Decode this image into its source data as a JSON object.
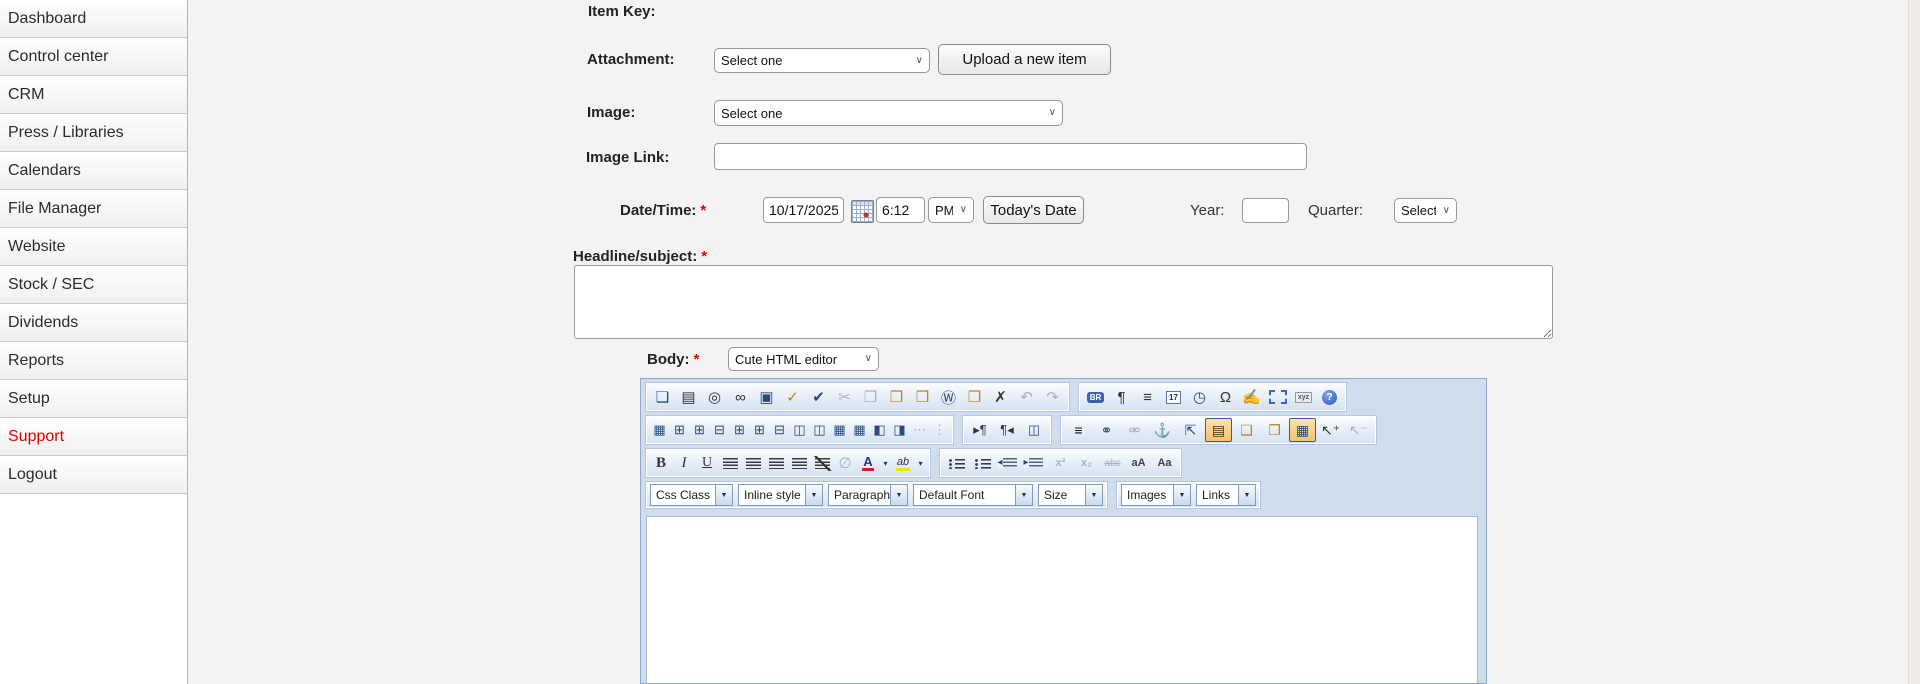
{
  "sidebar": {
    "items": [
      {
        "label": "Dashboard"
      },
      {
        "label": "Control center"
      },
      {
        "label": "CRM"
      },
      {
        "label": "Press / Libraries"
      },
      {
        "label": "Calendars"
      },
      {
        "label": "File Manager"
      },
      {
        "label": "Website"
      },
      {
        "label": "Stock / SEC"
      },
      {
        "label": "Dividends"
      },
      {
        "label": "Reports"
      },
      {
        "label": "Setup"
      },
      {
        "label": "Support"
      },
      {
        "label": "Logout"
      }
    ]
  },
  "form": {
    "item_key": {
      "label": "Item Key:"
    },
    "attachment": {
      "label": "Attachment:",
      "select_value": "Select one",
      "upload_button": "Upload a new item"
    },
    "image": {
      "label": "Image:",
      "select_value": "Select one"
    },
    "image_link": {
      "label": "Image Link:",
      "value": ""
    },
    "datetime": {
      "label": "Date/Time:",
      "required_mark": "*",
      "date_value": "10/17/2025",
      "time_value": "6:12",
      "ampm_value": "PM",
      "today_button": "Today's Date",
      "year_label": "Year:",
      "year_value": "",
      "quarter_label": "Quarter:",
      "quarter_value": "Select"
    },
    "headline": {
      "label": "Headline/subject:",
      "required_mark": "*",
      "value": ""
    },
    "body": {
      "label": "Body:",
      "required_mark": "*",
      "editor_select_value": "Cute HTML editor"
    }
  },
  "editor": {
    "toolbar": {
      "r1g1": [
        {
          "name": "new-document",
          "glyph": "❏"
        },
        {
          "name": "print",
          "glyph": "▤"
        },
        {
          "name": "print-preview",
          "glyph": "◎"
        },
        {
          "name": "find",
          "glyph": "∞"
        },
        {
          "name": "select-all",
          "glyph": "▣"
        },
        {
          "name": "spell-check-as-you-type",
          "glyph": "✓"
        },
        {
          "name": "spell-check",
          "glyph": "✔"
        },
        {
          "name": "cut",
          "glyph": "✂"
        },
        {
          "name": "copy",
          "glyph": "❐"
        },
        {
          "name": "paste",
          "glyph": "❒"
        },
        {
          "name": "paste-text",
          "glyph": "❒"
        },
        {
          "name": "paste-from-word",
          "glyph": "Ⓦ"
        },
        {
          "name": "paste-html",
          "glyph": "❒"
        },
        {
          "name": "delete",
          "glyph": "✗"
        },
        {
          "name": "undo",
          "glyph": "↶"
        },
        {
          "name": "redo",
          "glyph": "↷"
        }
      ],
      "r1g2": [
        {
          "name": "insert-line-break",
          "glyph": "BR"
        },
        {
          "name": "insert-paragraph",
          "glyph": "¶"
        },
        {
          "name": "insert-page-break",
          "glyph": "≡"
        },
        {
          "name": "insert-date",
          "glyph": "17"
        },
        {
          "name": "insert-time",
          "glyph": "◷"
        },
        {
          "name": "insert-special-character",
          "glyph": "Ω"
        },
        {
          "name": "universal-keyboard",
          "glyph": "✍"
        },
        {
          "name": "insert-template",
          "glyph": ""
        },
        {
          "name": "insert-custom-tag",
          "glyph": "xyz"
        },
        {
          "name": "help",
          "glyph": "?"
        }
      ],
      "r2g1": [
        {
          "name": "insert-table",
          "glyph": "▦"
        },
        {
          "name": "insert-row-above",
          "glyph": "⊞"
        },
        {
          "name": "insert-row-below",
          "glyph": "⊞"
        },
        {
          "name": "delete-row",
          "glyph": "⊟"
        },
        {
          "name": "insert-column-left",
          "glyph": "⊞"
        },
        {
          "name": "insert-column-right",
          "glyph": "⊞"
        },
        {
          "name": "delete-column",
          "glyph": "⊟"
        },
        {
          "name": "merge-cell-left",
          "glyph": "◫"
        },
        {
          "name": "merge-cell-down",
          "glyph": "◫"
        },
        {
          "name": "table-properties",
          "glyph": "▦"
        },
        {
          "name": "cell-properties",
          "glyph": "▦"
        },
        {
          "name": "merge-cells",
          "glyph": "◧"
        },
        {
          "name": "split-cell",
          "glyph": "◨"
        },
        {
          "name": "cell-padding",
          "glyph": "⋯"
        },
        {
          "name": "cell-spacing",
          "glyph": "⋮"
        }
      ],
      "r2g2": [
        {
          "name": "text-direction-ltr",
          "glyph": "▸¶"
        },
        {
          "name": "text-direction-rtl",
          "glyph": "¶◂"
        },
        {
          "name": "show-table-borders",
          "glyph": "◫"
        }
      ],
      "r2g3": [
        {
          "name": "insert-horizontal-rule",
          "glyph": "≡"
        },
        {
          "name": "insert-hyperlink",
          "glyph": "⚭"
        },
        {
          "name": "remove-hyperlink",
          "glyph": "⚮"
        },
        {
          "name": "insert-anchor",
          "glyph": "⚓"
        },
        {
          "name": "absolute-position",
          "glyph": "⇱"
        },
        {
          "name": "wrap-in-div",
          "glyph": "▤",
          "active": true
        },
        {
          "name": "send-backward",
          "glyph": "❑"
        },
        {
          "name": "bring-forward",
          "glyph": "❒"
        },
        {
          "name": "show-gridlines",
          "glyph": "▦",
          "active": true
        },
        {
          "name": "add-to-selection",
          "glyph": "↖⁺"
        },
        {
          "name": "remove-from-selection",
          "glyph": "↖⁻"
        }
      ],
      "r3g1": [
        {
          "name": "bold",
          "glyph": "B"
        },
        {
          "name": "italic",
          "glyph": "I"
        },
        {
          "name": "underline",
          "glyph": "U"
        },
        {
          "name": "justify-left",
          "glyph": ""
        },
        {
          "name": "justify-center",
          "glyph": ""
        },
        {
          "name": "justify-right",
          "glyph": ""
        },
        {
          "name": "justify-full",
          "glyph": ""
        },
        {
          "name": "justify-none",
          "glyph": ""
        },
        {
          "name": "remove-formatting",
          "glyph": "∅"
        },
        {
          "name": "font-color",
          "glyph": "A"
        },
        {
          "name": "font-color-menu",
          "glyph": "▾"
        },
        {
          "name": "highlight",
          "glyph": "ab"
        },
        {
          "name": "highlight-menu",
          "glyph": "▾"
        }
      ],
      "r3g2": [
        {
          "name": "numbered-list",
          "glyph": ""
        },
        {
          "name": "bullet-list",
          "glyph": ""
        },
        {
          "name": "outdent",
          "glyph": ""
        },
        {
          "name": "indent",
          "glyph": ""
        },
        {
          "name": "superscript",
          "glyph": "x²"
        },
        {
          "name": "subscript",
          "glyph": "x₂"
        },
        {
          "name": "strikethrough",
          "glyph": "abc"
        },
        {
          "name": "to-uppercase",
          "glyph": "aA"
        },
        {
          "name": "to-lowercase",
          "glyph": "Aa"
        }
      ],
      "r4": [
        {
          "name": "css-class-select",
          "label": "Css Class"
        },
        {
          "name": "inline-style-select",
          "label": "Inline style"
        },
        {
          "name": "paragraph-select",
          "label": "Paragraph"
        },
        {
          "name": "font-select",
          "label": "Default Font"
        },
        {
          "name": "size-select",
          "label": "Size"
        },
        {
          "name": "images-select",
          "label": "Images"
        },
        {
          "name": "links-select",
          "label": "Links"
        }
      ]
    },
    "content": {
      "text": ""
    }
  },
  "colors": {
    "support_link": "#e60000",
    "required_asterisk": "#e60000",
    "editor_panel_bg": "#cfddef",
    "editor_group_border": "#b4c7e0",
    "active_button_bg": "#f6c26d",
    "active_button_border": "#3a5a9a"
  }
}
